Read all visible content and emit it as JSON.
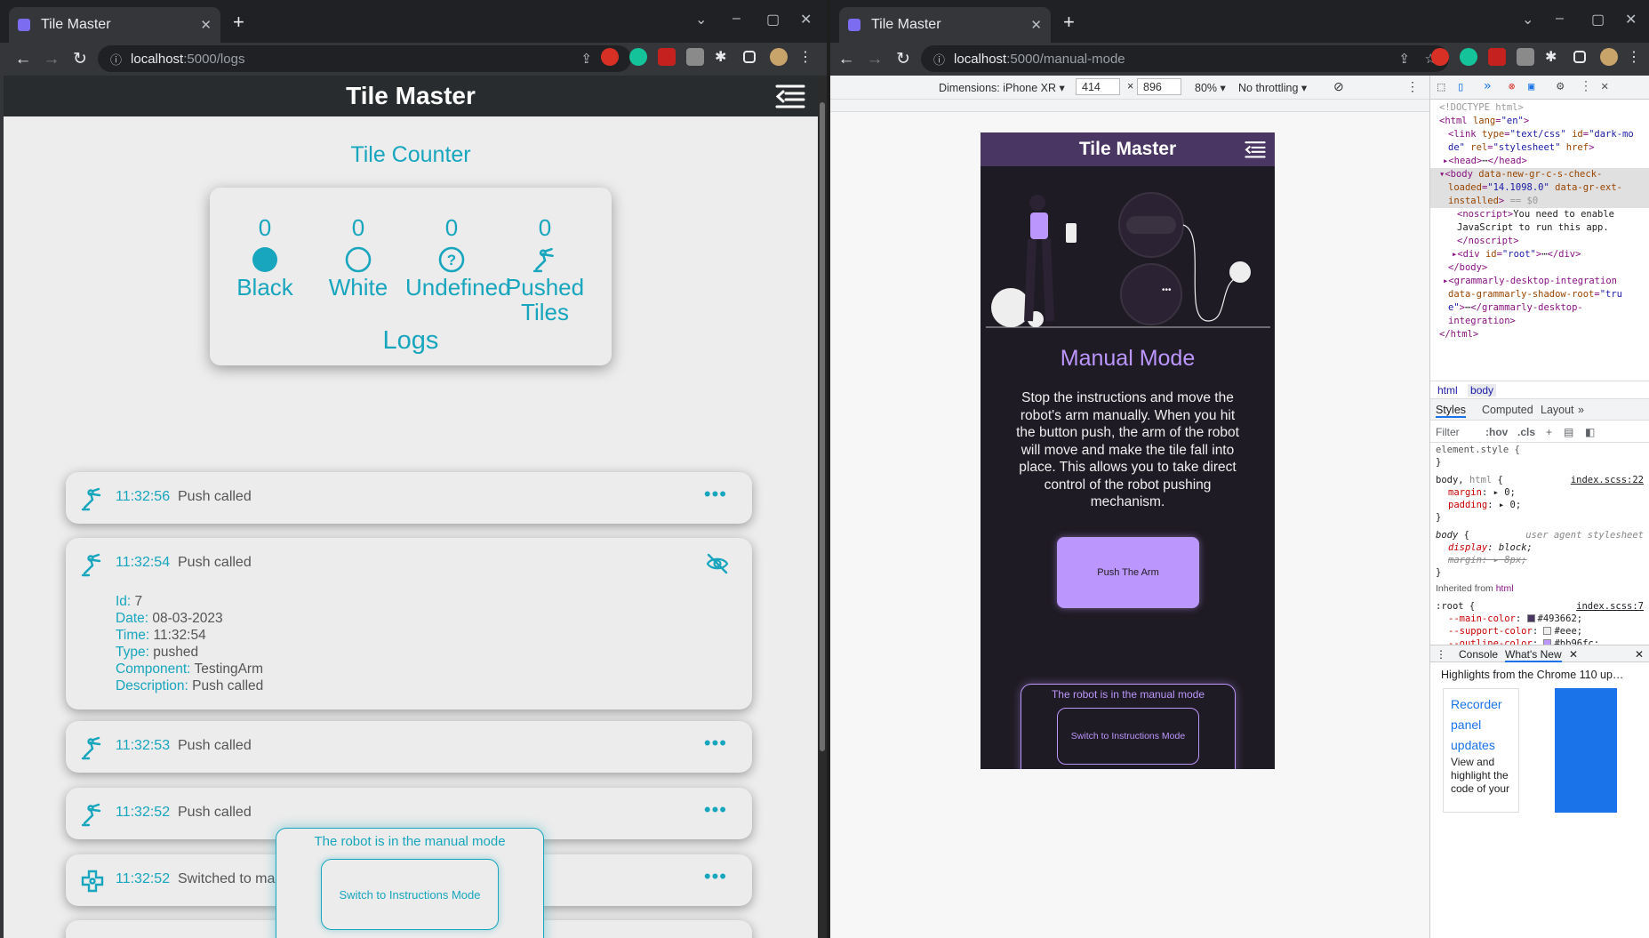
{
  "left_window": {
    "tab_title": "Tile Master",
    "url_host": "localhost",
    "url_path": ":5000/logs",
    "app_title": "Tile Master",
    "counter_title": "Tile Counter",
    "counters": [
      {
        "value": "0",
        "label": "Black",
        "icon": "filled-circle-icon"
      },
      {
        "value": "0",
        "label": "White",
        "icon": "empty-circle-icon"
      },
      {
        "value": "0",
        "label": "Undefined",
        "icon": "question-circle-icon"
      },
      {
        "value": "0",
        "label": "Pushed Tiles",
        "icon": "robot-arm-icon"
      }
    ],
    "logs_title": "Logs",
    "logs": [
      {
        "time": "11:32:56",
        "desc": "Push called",
        "icon": "robot-arm-icon"
      },
      {
        "time": "11:32:54",
        "desc": "Push called",
        "icon": "robot-arm-icon",
        "expanded": true
      },
      {
        "time": "11:32:53",
        "desc": "Push called",
        "icon": "robot-arm-icon"
      },
      {
        "time": "11:32:52",
        "desc": "Push called",
        "icon": "robot-arm-icon"
      },
      {
        "time": "11:32:52",
        "desc": "Switched to ma",
        "icon": "gamepad-icon"
      }
    ],
    "details": {
      "id_label": "Id:",
      "id": "7",
      "date_label": "Date:",
      "date": "08-03-2023",
      "time_label": "Time:",
      "time": "11:32:54",
      "type_label": "Type:",
      "type": "pushed",
      "component_label": "Component:",
      "component": "TestingArm",
      "description_label": "Description:",
      "description": "Push called"
    },
    "popup_text": "The robot is in the manual mode",
    "popup_button": "Switch to Instructions Mode"
  },
  "right_window": {
    "tab_title": "Tile Master",
    "url_host": "localhost",
    "url_path": ":5000/manual-mode",
    "device": "Dimensions: iPhone XR",
    "width": "414",
    "height": "896",
    "zoom": "80%",
    "throttling": "No throttling",
    "app_title": "Tile Master",
    "page_title": "Manual Mode",
    "description": "Stop the instructions and move the robot's arm manually. When you hit the button push, the arm of the robot will move and make the tile fall into place. This allows you to take direct control of the robot pushing mechanism.",
    "push_button": "Push The Arm",
    "status_text": "The robot is in the manual mode",
    "switch_button": "Switch to Instructions Mode"
  },
  "devtools": {
    "breadcrumb_html": "html",
    "breadcrumb_body": "body",
    "tabs": [
      "Styles",
      "Computed",
      "Layout"
    ],
    "filter_placeholder": "Filter",
    "hov": ":hov",
    "cls": ".cls",
    "drawer_console": "Console",
    "drawer_whatsnew": "What's New",
    "news_header": "Highlights from the Chrome 110 up…",
    "news_link_1": "Recorder",
    "news_link_2": "panel",
    "news_link_3": "updates",
    "news_text": "View and highlight the code of your"
  },
  "colors": {
    "teal": "#17a6bd",
    "main": "#493662",
    "support": "#eee",
    "outline": "#bb96fc",
    "background": "#1f1b24"
  }
}
